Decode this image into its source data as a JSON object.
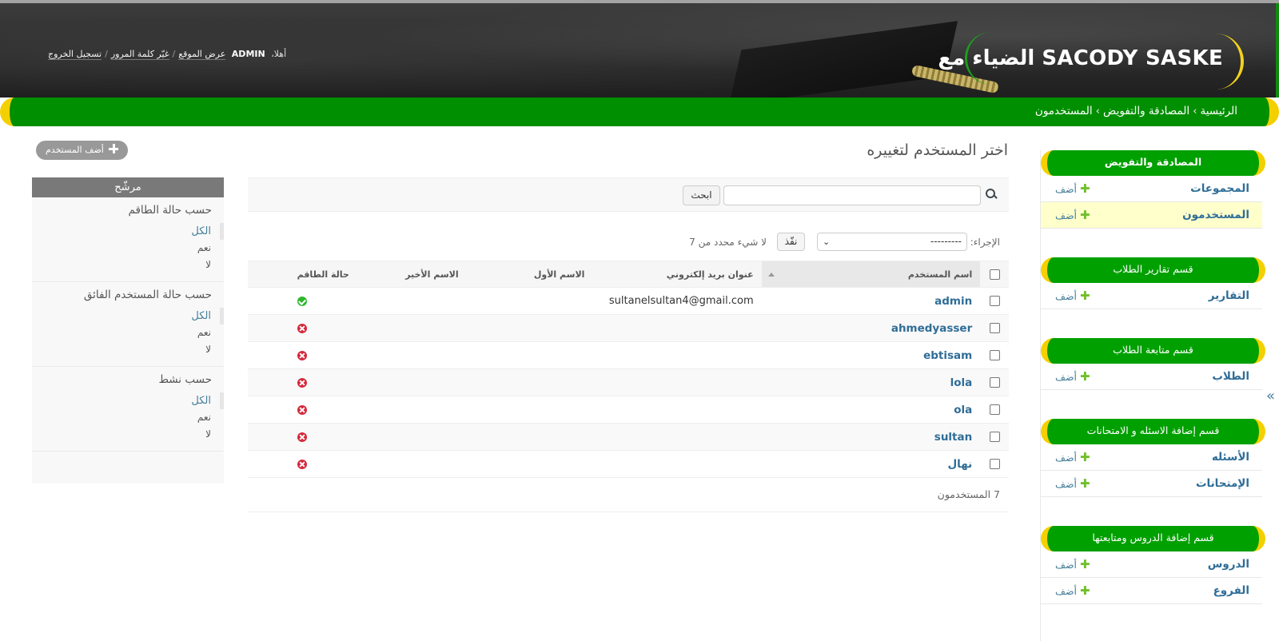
{
  "header": {
    "brand": "الضياء مع SACODY SASKE",
    "welcome": "أهلا،",
    "username": "ADMIN",
    "links": [
      "عرض الموقع",
      "غيّر كلمة المرور",
      "تسجيل الخروج"
    ]
  },
  "breadcrumbs": [
    "الرئيسية",
    "المصادقة والتفويض",
    "المستخدمون"
  ],
  "breadcrumb_sep": "›",
  "nav": {
    "add_label": "أضف",
    "modules": [
      {
        "caption": "المصادقة والتفويض",
        "rows": [
          {
            "label": "المجموعات"
          },
          {
            "label": "المستخدمون"
          }
        ]
      },
      {
        "caption": "قسم تقارير الطلاب",
        "rows": [
          {
            "label": "التقارير"
          }
        ]
      },
      {
        "caption": "قسم متابعة الطلاب",
        "rows": [
          {
            "label": "الطلاب"
          }
        ]
      },
      {
        "caption": "قسم إضافة الاسئله و الامتحانات",
        "rows": [
          {
            "label": "الأسئله"
          },
          {
            "label": "الإمتحانات"
          }
        ]
      },
      {
        "caption": "قسم إضافة الدروس ومتابعتها",
        "rows": [
          {
            "label": "الدروس"
          },
          {
            "label": "الفروع"
          }
        ]
      }
    ],
    "toggle": "«"
  },
  "main": {
    "title": "اختر المستخدم لتغييره",
    "add_button": "أضف المستخدم",
    "search": {
      "button": "ابحث",
      "value": ""
    },
    "actions": {
      "label": "الإجراء:",
      "selected": "---------",
      "go": "نفّذ",
      "counter": "لا شيء محدد من 7"
    },
    "table": {
      "headers": [
        "اسم المستخدم",
        "عنوان بريد إلكتروني",
        "الاسم الأول",
        "الاسم الأخير",
        "حالة الطاقم"
      ],
      "rows": [
        {
          "username": "admin",
          "email": "sultanelsultan4@gmail.com",
          "first": "",
          "last": "",
          "staff": true
        },
        {
          "username": "ahmedyasser",
          "email": "",
          "first": "",
          "last": "",
          "staff": false
        },
        {
          "username": "ebtisam",
          "email": "",
          "first": "",
          "last": "",
          "staff": false
        },
        {
          "username": "lola",
          "email": "",
          "first": "",
          "last": "",
          "staff": false
        },
        {
          "username": "ola",
          "email": "",
          "first": "",
          "last": "",
          "staff": false
        },
        {
          "username": "sultan",
          "email": "",
          "first": "",
          "last": "",
          "staff": false
        },
        {
          "username": "نهال",
          "email": "",
          "first": "",
          "last": "",
          "staff": false
        }
      ]
    },
    "paginator": "7 المستخدمون"
  },
  "filter": {
    "title": "مرشّح",
    "groups": [
      {
        "title": "حسب حالة الطاقم",
        "options": [
          "الكل",
          "نعم",
          "لا"
        ]
      },
      {
        "title": "حسب حالة المستخدم الفائق",
        "options": [
          "الكل",
          "نعم",
          "لا"
        ]
      },
      {
        "title": "حسب نشط",
        "options": [
          "الكل",
          "نعم",
          "لا"
        ]
      }
    ]
  },
  "colors": {
    "green_bar": "#008f00",
    "module_green": "#00a000",
    "yellow_accent": "#f4d000",
    "link_blue": "#2f6d97"
  },
  "icons": [
    "search-icon",
    "plus-icon",
    "check-circle-icon",
    "x-circle-icon",
    "sort-ascending-icon",
    "collapse-sidebar-icon"
  ]
}
